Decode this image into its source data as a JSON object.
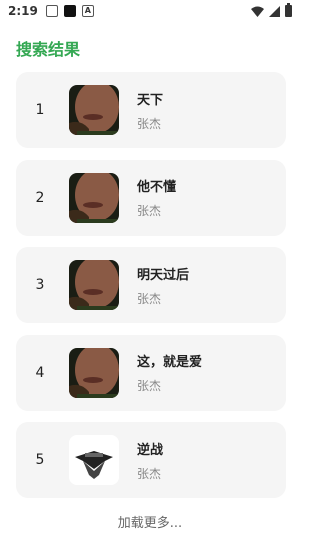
{
  "status": {
    "time": "2:19"
  },
  "header": {
    "title": "搜索结果"
  },
  "results": [
    {
      "rank": "1",
      "title": "天下",
      "artist": "张杰",
      "cover_icon": "album-cover-portrait-icon"
    },
    {
      "rank": "2",
      "title": "他不懂",
      "artist": "张杰",
      "cover_icon": "album-cover-portrait-icon"
    },
    {
      "rank": "3",
      "title": "明天过后",
      "artist": "张杰",
      "cover_icon": "album-cover-portrait-icon"
    },
    {
      "rank": "4",
      "title": "这，就是爱",
      "artist": "张杰",
      "cover_icon": "album-cover-portrait-icon"
    },
    {
      "rank": "5",
      "title": "逆战",
      "artist": "张杰",
      "cover_icon": "album-cover-logo-icon"
    }
  ],
  "footer": {
    "load_more": "加载更多..."
  },
  "colors": {
    "title_green": "#34a853",
    "card_bg": "#f5f5f5"
  }
}
